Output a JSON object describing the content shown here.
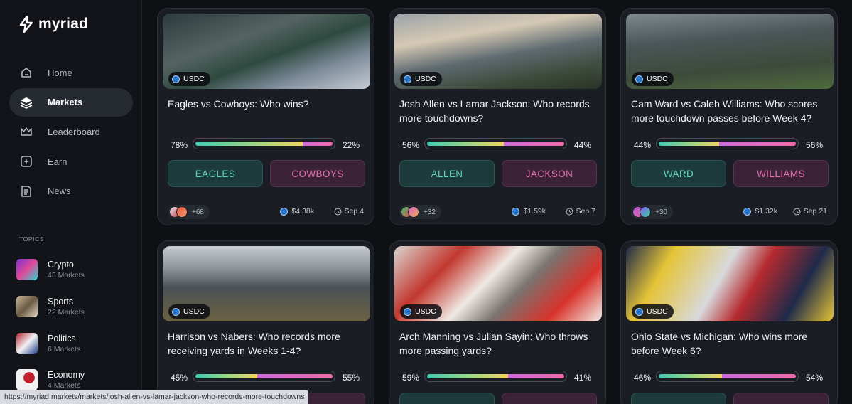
{
  "brand": {
    "name": "myriad"
  },
  "nav": [
    {
      "label": "Home",
      "icon": "home-icon",
      "active": false
    },
    {
      "label": "Markets",
      "icon": "layers-icon",
      "active": true
    },
    {
      "label": "Leaderboard",
      "icon": "crown-icon",
      "active": false
    },
    {
      "label": "Earn",
      "icon": "earn-icon",
      "active": false
    },
    {
      "label": "News",
      "icon": "news-icon",
      "active": false
    }
  ],
  "topics_label": "TOPICS",
  "topics": [
    {
      "name": "Crypto",
      "count": "43 Markets"
    },
    {
      "name": "Sports",
      "count": "22 Markets"
    },
    {
      "name": "Politics",
      "count": "6 Markets"
    },
    {
      "name": "Economy",
      "count": "4 Markets"
    }
  ],
  "markets": [
    {
      "token": "USDC",
      "title": "Eagles vs Cowboys: Who wins?",
      "pct_a": "78%",
      "pct_b": "22%",
      "share_a": 0.78,
      "option_a": "EAGLES",
      "option_b": "COWBOYS",
      "participants": "+68",
      "volume": "$4.38k",
      "date": "Sep 4"
    },
    {
      "token": "USDC",
      "title": "Josh Allen vs Lamar Jackson: Who records more touchdowns?",
      "pct_a": "56%",
      "pct_b": "44%",
      "share_a": 0.56,
      "option_a": "ALLEN",
      "option_b": "JACKSON",
      "participants": "+32",
      "volume": "$1.59k",
      "date": "Sep 7"
    },
    {
      "token": "USDC",
      "title": "Cam Ward vs Caleb Williams: Who scores more touchdown passes before Week 4?",
      "pct_a": "44%",
      "pct_b": "56%",
      "share_a": 0.44,
      "option_a": "WARD",
      "option_b": "WILLIAMS",
      "participants": "+30",
      "volume": "$1.32k",
      "date": "Sep 21"
    },
    {
      "token": "USDC",
      "title": "Harrison vs Nabers: Who records more receiving yards in Weeks 1-4?",
      "pct_a": "45%",
      "pct_b": "55%",
      "share_a": 0.45,
      "option_a": "",
      "option_b": ""
    },
    {
      "token": "USDC",
      "title": "Arch Manning vs Julian Sayin: Who throws more passing yards?",
      "pct_a": "59%",
      "pct_b": "41%",
      "share_a": 0.59,
      "option_a": "",
      "option_b": ""
    },
    {
      "token": "USDC",
      "title": "Ohio State vs Michigan: Who wins more before Week 6?",
      "pct_a": "46%",
      "pct_b": "54%",
      "share_a": 0.46,
      "option_a": "",
      "option_b": ""
    }
  ],
  "status_url": "https://myriad.markets/markets/josh-allen-vs-lamar-jackson-who-records-more-touchdowns"
}
